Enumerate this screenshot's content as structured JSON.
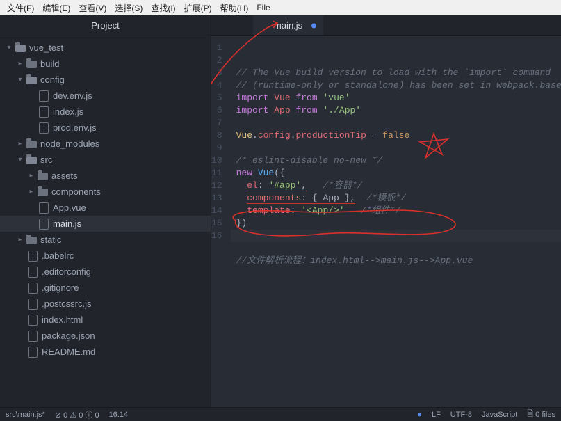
{
  "menu": {
    "items": [
      "文件(F)",
      "编辑(E)",
      "查看(V)",
      "选择(S)",
      "查找(I)",
      "扩展(P)",
      "帮助(H)",
      "File"
    ]
  },
  "panel": {
    "title": "Project"
  },
  "tree": {
    "root": "vue_test",
    "build": "build",
    "config": "config",
    "dev_env": "dev.env.js",
    "index_js": "index.js",
    "prod_env": "prod.env.js",
    "node_modules": "node_modules",
    "src": "src",
    "assets": "assets",
    "components": "components",
    "app_vue": "App.vue",
    "main_js": "main.js",
    "static": "static",
    "babelrc": ".babelrc",
    "editorconfig": ".editorconfig",
    "gitignore": ".gitignore",
    "postcssrc": ".postcssrc.js",
    "index_html": "index.html",
    "package_json": "package.json",
    "readme": "README.md"
  },
  "tab": {
    "label": "main.js"
  },
  "code": {
    "l1": "// The Vue build version to load with the `import` command",
    "l2": "// (runtime-only or standalone) has been set in webpack.base.conf wit",
    "l3_kw1": "import",
    "l3_def1": "Vue",
    "l3_kw2": "from",
    "l3_str1": "'vue'",
    "l4_kw1": "import",
    "l4_def1": "App",
    "l4_kw2": "from",
    "l4_str1": "'./App'",
    "l6_obj": "Vue",
    "l6_dot1": ".",
    "l6_p1": "config",
    "l6_dot2": ".",
    "l6_p2": "productionTip",
    "l6_eq": " = ",
    "l6_bool": "false",
    "l8": "/* eslint-disable no-new */",
    "l9_kw": "new",
    "l9_cls": "Vue",
    "l9_open": "({",
    "l10_prop": "el",
    "l10_colon": ": ",
    "l10_str": "'#app'",
    "l10_comma": ",",
    "l10_cmt": "   /*容器*/",
    "l11_prop": "components",
    "l11_colon": ": ",
    "l11_val": "{ App }",
    "l11_comma": ",",
    "l11_cmt": "  /*模板*/",
    "l12_prop": "template",
    "l12_colon": ": ",
    "l12_str": "'<App/>'",
    "l12_cmt": "   /*组件*/",
    "l13": "})",
    "l16": "//文件解析流程：index.html-->main.js-->App.vue"
  },
  "gutter": [
    "1",
    "2",
    "3",
    "4",
    "5",
    "6",
    "7",
    "8",
    "9",
    "10",
    "11",
    "12",
    "13",
    "14",
    "15",
    "16"
  ],
  "status": {
    "path": "src\\main.js*",
    "diag": "⊘ 0 ⚠ 0 ⓘ 0",
    "cursor": "16:14",
    "dot": "●",
    "lf": "LF",
    "enc": "UTF-8",
    "lang": "JavaScript",
    "files": "0 files",
    "files_icon": "🗎"
  }
}
